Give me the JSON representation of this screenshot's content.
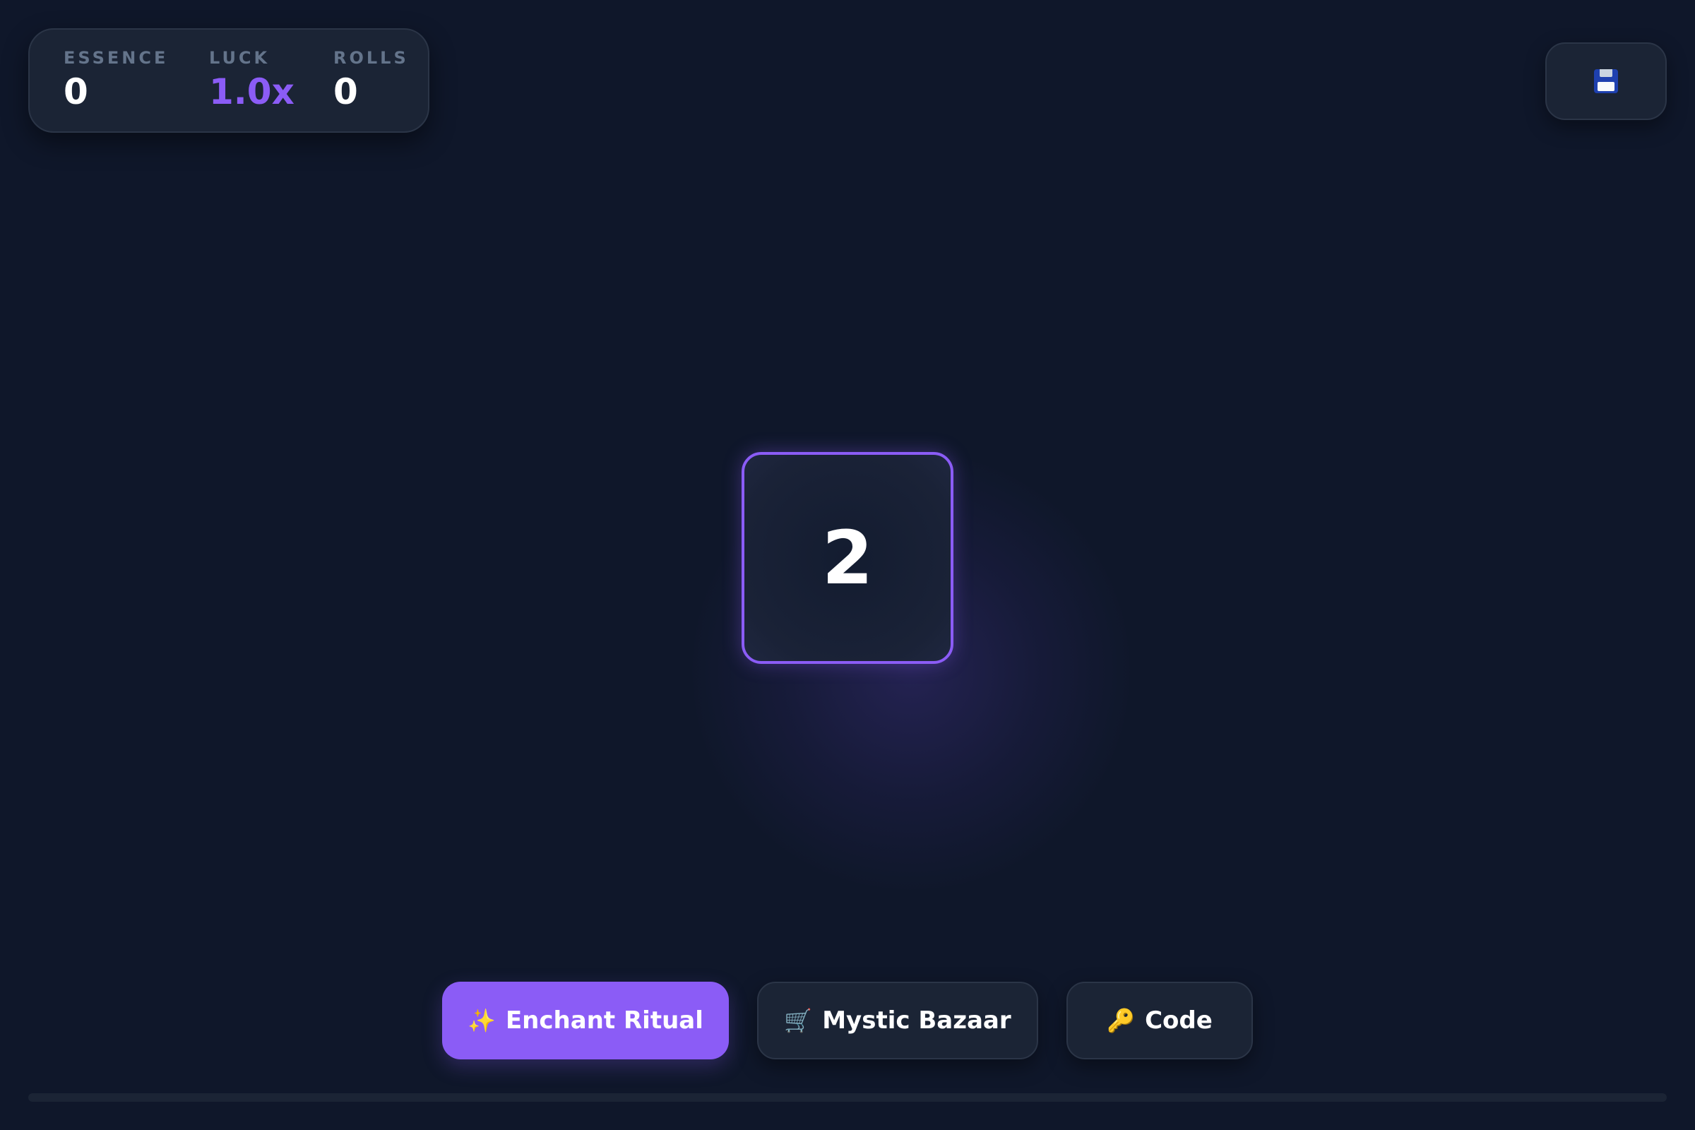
{
  "stats": {
    "essence": {
      "label": "ESSENCE",
      "value": "0"
    },
    "luck": {
      "label": "LUCK",
      "value": "1.0x"
    },
    "rolls": {
      "label": "ROLLS",
      "value": "0"
    }
  },
  "save_button": {
    "icon": "floppy-disk-icon"
  },
  "dice": {
    "value": "2"
  },
  "actions": {
    "enchant": {
      "icon": "✨",
      "icon_name": "sparkles-icon",
      "label": "Enchant Ritual"
    },
    "bazaar": {
      "icon": "🛒",
      "icon_name": "shopping-cart-icon",
      "label": "Mystic Bazaar"
    },
    "code": {
      "icon": "🔑",
      "icon_name": "key-icon",
      "label": "Code"
    }
  },
  "progress": {
    "fraction": 0
  },
  "colors": {
    "background": "#0f172a",
    "panel": "#1b2435",
    "accent": "#8b5cf6",
    "muted_text": "#64748b"
  }
}
